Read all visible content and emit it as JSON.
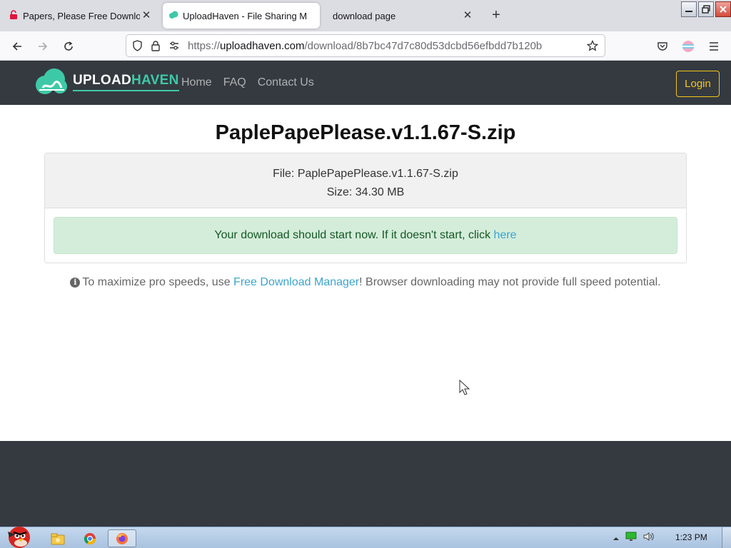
{
  "browser": {
    "tabs": [
      {
        "title": "Papers, Please Free Download",
        "active": false
      },
      {
        "title": "UploadHaven - File Sharing M",
        "active": true
      },
      {
        "title": "download page",
        "active": false
      }
    ],
    "url_prefix": "https://",
    "url_domain": "uploadhaven.com",
    "url_path": "/download/8b7bc47d7c80d53dcbd56efbdd7b120b"
  },
  "site": {
    "logo_upload": "UPLOAD",
    "logo_haven": "HAVEN",
    "nav": [
      "Home",
      "FAQ",
      "Contact Us"
    ],
    "login": "Login"
  },
  "content": {
    "title": "PaplePapePlease.v1.1.67-S.zip",
    "file_line": "File: PaplePapePlease.v1.1.67-S.zip",
    "size_line": "Size: 34.30 MB",
    "alert_text": "Your download should start now. If it doesn't start, click ",
    "alert_link": "here",
    "hint_before": "To maximize pro speeds, use ",
    "hint_link": "Free Download Manager",
    "hint_after": "! Browser downloading may not provide full speed potential."
  },
  "taskbar": {
    "clock": "1:23 PM"
  },
  "colors": {
    "header_bg": "#343a40",
    "accent": "#3dc9a7",
    "login_border": "#f5c518",
    "alert_bg": "#d4edda",
    "link": "#3ba4cf"
  }
}
